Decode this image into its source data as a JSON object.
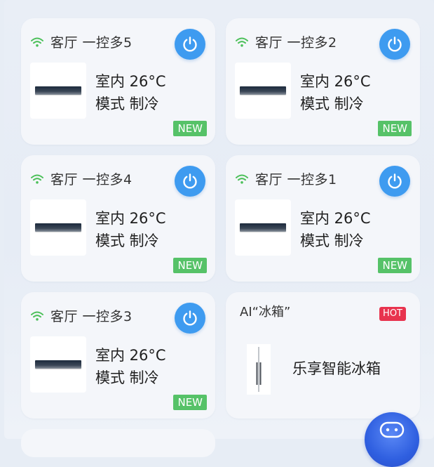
{
  "devices": [
    {
      "name": "客厅  一控多5",
      "temp": "室内 26°C",
      "mode": "模式 制冷",
      "badge": "NEW"
    },
    {
      "name": "客厅  一控多2",
      "temp": "室内 26°C",
      "mode": "模式 制冷",
      "badge": "NEW"
    },
    {
      "name": "客厅  一控多4",
      "temp": "室内 26°C",
      "mode": "模式 制冷",
      "badge": "NEW"
    },
    {
      "name": "客厅  一控多1",
      "temp": "室内 26°C",
      "mode": "模式 制冷",
      "badge": "NEW"
    },
    {
      "name": "客厅  一控多3",
      "temp": "室内 26°C",
      "mode": "模式 制冷",
      "badge": "NEW"
    }
  ],
  "promo": {
    "title": "AI“冰箱”",
    "badge": "HOT",
    "text": "乐享智能冰箱"
  },
  "icons": {
    "wifi": "wifi-icon",
    "power": "power-icon",
    "device": "ac-unit-icon",
    "fridge": "fridge-icon",
    "assistant": "robot-icon"
  },
  "colors": {
    "power_button": "#3e9bf0",
    "new_badge": "#56c268",
    "hot_badge": "#e8334e",
    "wifi": "#4cc05a",
    "assistant": "#2f5fe0"
  }
}
